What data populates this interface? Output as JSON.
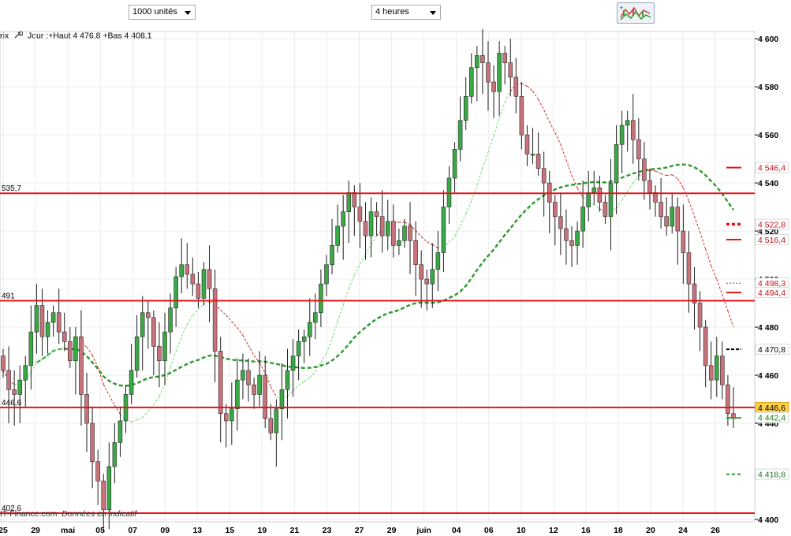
{
  "toolbar": {
    "volume_select": "1000 unités",
    "period_select": "4 heures",
    "indicator_button_icon": "indicator-chart-icon"
  },
  "header": {
    "left_clip": "rix",
    "info": "Jour :+Haut 4 476,8 +Bas 4 408,1",
    "wrench_icon": "wrench-icon"
  },
  "watermark": {
    "source": "IT-Finance.com",
    "note": "Données en indicatif"
  },
  "colors": {
    "up": "#3aa845",
    "down": "#c8737b",
    "level_line": "#e0161b",
    "ma_slow": "#2c9a2c",
    "ma_fast_up": "#7be07b",
    "ma_fast_down": "#d63a3a",
    "grid": "#ececec"
  },
  "chart_data": {
    "type": "candlestick",
    "y_range": [
      4399,
      4603
    ],
    "y_ticks": [
      {
        "value": 4600,
        "label": "4 600"
      },
      {
        "value": 4580,
        "label": "4 580"
      },
      {
        "value": 4560,
        "label": "4 560"
      },
      {
        "value": 4540,
        "label": "4 540"
      },
      {
        "value": 4520,
        "label": "4 520"
      },
      {
        "value": 4500,
        "label": "4 500"
      },
      {
        "value": 4480,
        "label": "4 480"
      },
      {
        "value": 4460,
        "label": "4 460"
      },
      {
        "value": 4440,
        "label": "4 440"
      },
      {
        "value": 4400,
        "label": "4 400"
      }
    ],
    "x_ticks": [
      "25",
      "29",
      "mai",
      "05",
      "07",
      "09",
      "13",
      "15",
      "19",
      "21",
      "23",
      "27",
      "29",
      "juin",
      "04",
      "06",
      "10",
      "12",
      "16",
      "18",
      "20",
      "24",
      "26"
    ],
    "levels": [
      {
        "value": 4535.7,
        "label": "535,7"
      },
      {
        "value": 4491,
        "label": "491"
      },
      {
        "value": 4446.6,
        "label": "446,6"
      },
      {
        "value": 4402.6,
        "label": "402,6"
      }
    ],
    "price_markers": [
      {
        "value": 4546.4,
        "label": "4 546,4",
        "style": "red-solid"
      },
      {
        "value": 4522.8,
        "label": "4 522,8",
        "style": "red-dashed"
      },
      {
        "value": 4516.4,
        "label": "4 516,4",
        "style": "red-solid"
      },
      {
        "value": 4498.3,
        "label": "4 498,3",
        "style": "red-dotted"
      },
      {
        "value": 4494.4,
        "label": "4 494,4",
        "style": "red-solid"
      },
      {
        "value": 4470.8,
        "label": "4 470,8",
        "style": "black-dashed"
      },
      {
        "value": 4446.6,
        "label": "4 446,6",
        "style": "yellow-box"
      },
      {
        "value": 4442.4,
        "label": "4 442,4",
        "style": "green-solid"
      },
      {
        "value": 4418.8,
        "label": "4 418,8",
        "style": "green-dashed"
      }
    ],
    "candle_closes": [
      4462,
      4454,
      4452,
      4458,
      4464,
      4478,
      4489,
      4476,
      4482,
      4486,
      4478,
      4474,
      4466,
      4476,
      4452,
      4440,
      4424,
      4416,
      4404,
      4422,
      4432,
      4441,
      4452,
      4462,
      4476,
      4486,
      4484,
      4472,
      4466,
      4478,
      4488,
      4501,
      4506,
      4502,
      4498,
      4492,
      4504,
      4496,
      4470,
      4444,
      4441,
      4446,
      4458,
      4462,
      4456,
      4452,
      4460,
      4442,
      4436,
      4446,
      4454,
      4462,
      4468,
      4474,
      4476,
      4482,
      4486,
      4498,
      4506,
      4514,
      4522,
      4528,
      4536,
      4530,
      4524,
      4518,
      4528,
      4526,
      4518,
      4524,
      4514,
      4516,
      4522,
      4516,
      4506,
      4500,
      4498,
      4504,
      4511,
      4530,
      4542,
      4554,
      4566,
      4576,
      4588,
      4593,
      4590,
      4582,
      4578,
      4594,
      4590,
      4584,
      4576,
      4560,
      4552,
      4552,
      4546,
      4540,
      4532,
      4526,
      4521,
      4516,
      4514,
      4520,
      4530,
      4536,
      4538,
      4532,
      4526,
      4540,
      4556,
      4564,
      4566,
      4558,
      4550,
      4541,
      4536,
      4532,
      4526,
      4522,
      4530,
      4520,
      4511,
      4498,
      4490,
      4480,
      4464,
      4458,
      4468,
      4456,
      4444,
      4442
    ]
  }
}
